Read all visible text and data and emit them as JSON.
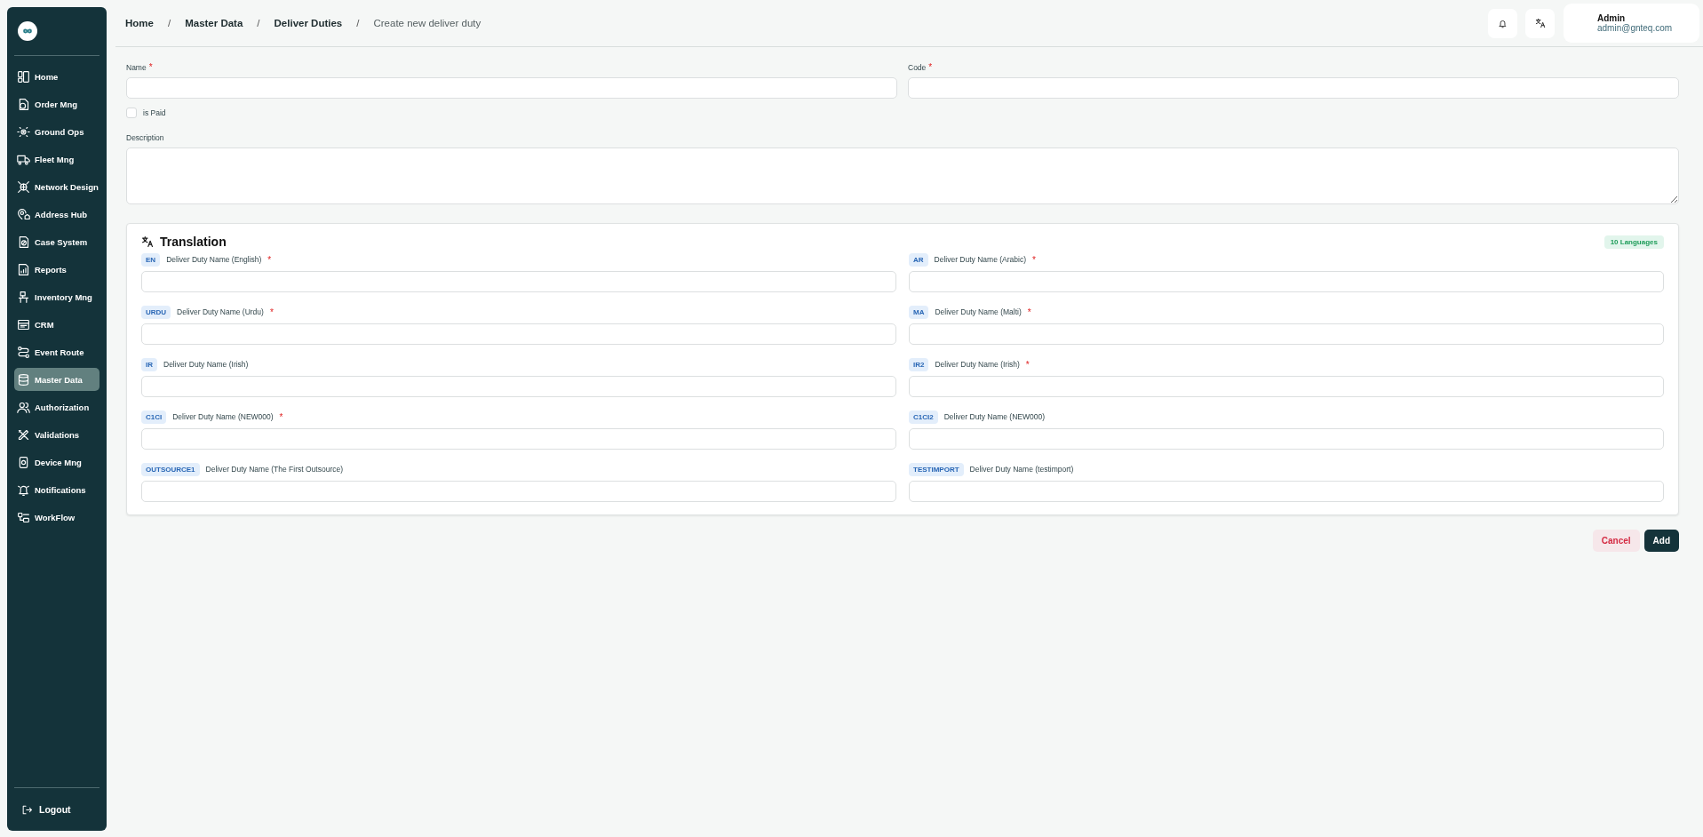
{
  "sidebar": {
    "items": [
      {
        "label": "Home",
        "selected": false
      },
      {
        "label": "Order Mng",
        "selected": false
      },
      {
        "label": "Ground Ops",
        "selected": false
      },
      {
        "label": "Fleet Mng",
        "selected": false
      },
      {
        "label": "Network Design",
        "selected": false
      },
      {
        "label": "Address Hub",
        "selected": false
      },
      {
        "label": "Case System",
        "selected": false
      },
      {
        "label": "Reports",
        "selected": false
      },
      {
        "label": "Inventory Mng",
        "selected": false
      },
      {
        "label": "CRM",
        "selected": false
      },
      {
        "label": "Event Route",
        "selected": false
      },
      {
        "label": "Master Data",
        "selected": true
      },
      {
        "label": "Authorization",
        "selected": false
      },
      {
        "label": "Validations",
        "selected": false
      },
      {
        "label": "Device Mng",
        "selected": false
      },
      {
        "label": "Notifications",
        "selected": false
      },
      {
        "label": "WorkFlow",
        "selected": false
      }
    ],
    "logout": "Logout"
  },
  "header": {
    "breadcrumbs": [
      {
        "label": "Home",
        "current": false
      },
      {
        "label": "Master Data",
        "current": false
      },
      {
        "label": "Deliver Duties",
        "current": false
      },
      {
        "label": "Create new deliver duty",
        "current": true
      }
    ],
    "separator": "/",
    "user": {
      "name": "Admin",
      "email": "admin@gnteq.com"
    }
  },
  "form": {
    "name": {
      "label": "Name",
      "required_mark": "*"
    },
    "code": {
      "label": "Code",
      "required_mark": "*"
    },
    "is_paid": {
      "label": "is Paid",
      "checked": false
    },
    "description": {
      "label": "Description"
    }
  },
  "translation": {
    "title": "Translation",
    "badge": "10 Languages",
    "fields": [
      {
        "code": "EN",
        "label": "Deliver Duty Name (English)",
        "required_mark": "*"
      },
      {
        "code": "AR",
        "label": "Deliver Duty Name (Arabic)",
        "required_mark": "*"
      },
      {
        "code": "URDU",
        "label": "Deliver Duty Name (Urdu)",
        "required_mark": "*"
      },
      {
        "code": "MA",
        "label": "Deliver Duty Name (Malti)",
        "required_mark": "*"
      },
      {
        "code": "IR",
        "label": "Deliver Duty Name (Irish)"
      },
      {
        "code": "IR2",
        "label": "Deliver Duty Name (Irish)",
        "required_mark": "*"
      },
      {
        "code": "C1CI",
        "label": "Deliver Duty Name (NEW000)",
        "required_mark": "*"
      },
      {
        "code": "C1CI2",
        "label": "Deliver Duty Name (NEW000)"
      },
      {
        "code": "OUTSOURCE1",
        "label": "Deliver Duty Name (The First Outsource)"
      },
      {
        "code": "TESTIMPORT",
        "label": "Deliver Duty Name (testimport)"
      }
    ]
  },
  "actions": [
    {
      "label": "Cancel",
      "kind": "secondary"
    },
    {
      "label": "Add",
      "kind": "primary"
    }
  ]
}
